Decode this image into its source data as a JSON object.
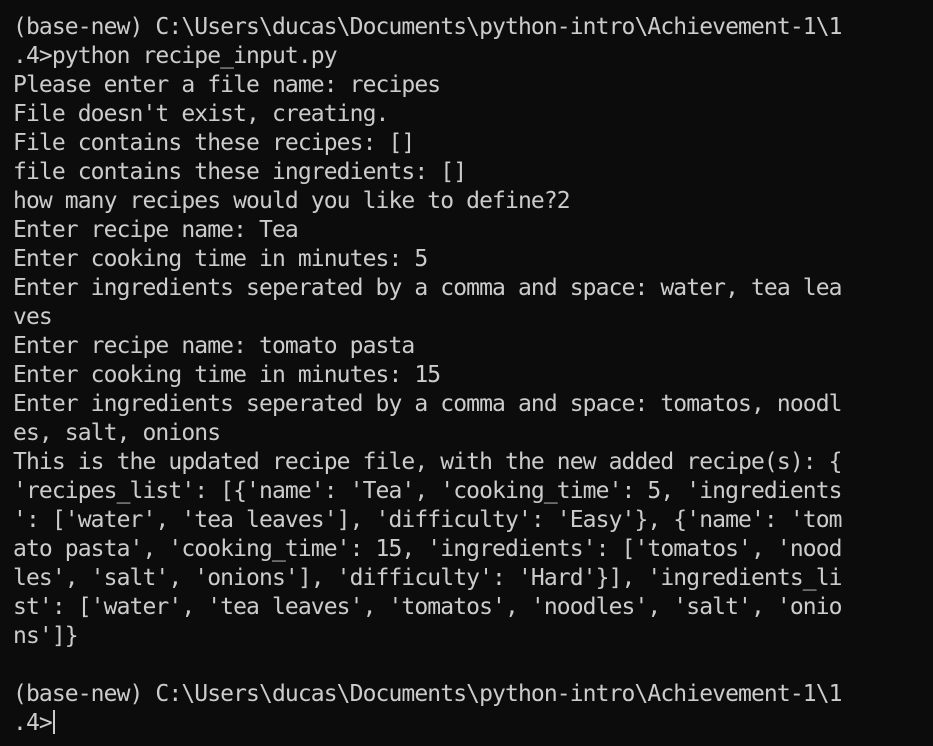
{
  "terminal": {
    "lines": [
      "(base-new) C:\\Users\\ducas\\Documents\\python-intro\\Achievement-1\\1",
      ".4>python recipe_input.py",
      "Please enter a file name: recipes",
      "File doesn't exist, creating.",
      "File contains these recipes: []",
      "file contains these ingredients: []",
      "how many recipes would you like to define?2",
      "Enter recipe name: Tea",
      "Enter cooking time in minutes: 5",
      "Enter ingredients seperated by a comma and space: water, tea lea",
      "ves",
      "Enter recipe name: tomato pasta",
      "Enter cooking time in minutes: 15",
      "Enter ingredients seperated by a comma and space: tomatos, noodl",
      "es, salt, onions",
      "This is the updated recipe file, with the new added recipe(s): {",
      "'recipes_list': [{'name': 'Tea', 'cooking_time': 5, 'ingredients",
      "': ['water', 'tea leaves'], 'difficulty': 'Easy'}, {'name': 'tom",
      "ato pasta', 'cooking_time': 15, 'ingredients': ['tomatos', 'nood",
      "les', 'salt', 'onions'], 'difficulty': 'Hard'}], 'ingredients_li",
      "st': ['water', 'tea leaves', 'tomatos', 'noodles', 'salt', 'onio",
      "ns']}",
      "",
      "(base-new) C:\\Users\\ducas\\Documents\\python-intro\\Achievement-1\\1"
    ],
    "prompt_tail": ".4>",
    "colors": {
      "background": "#0c0c0c",
      "foreground": "#cccccc"
    }
  }
}
